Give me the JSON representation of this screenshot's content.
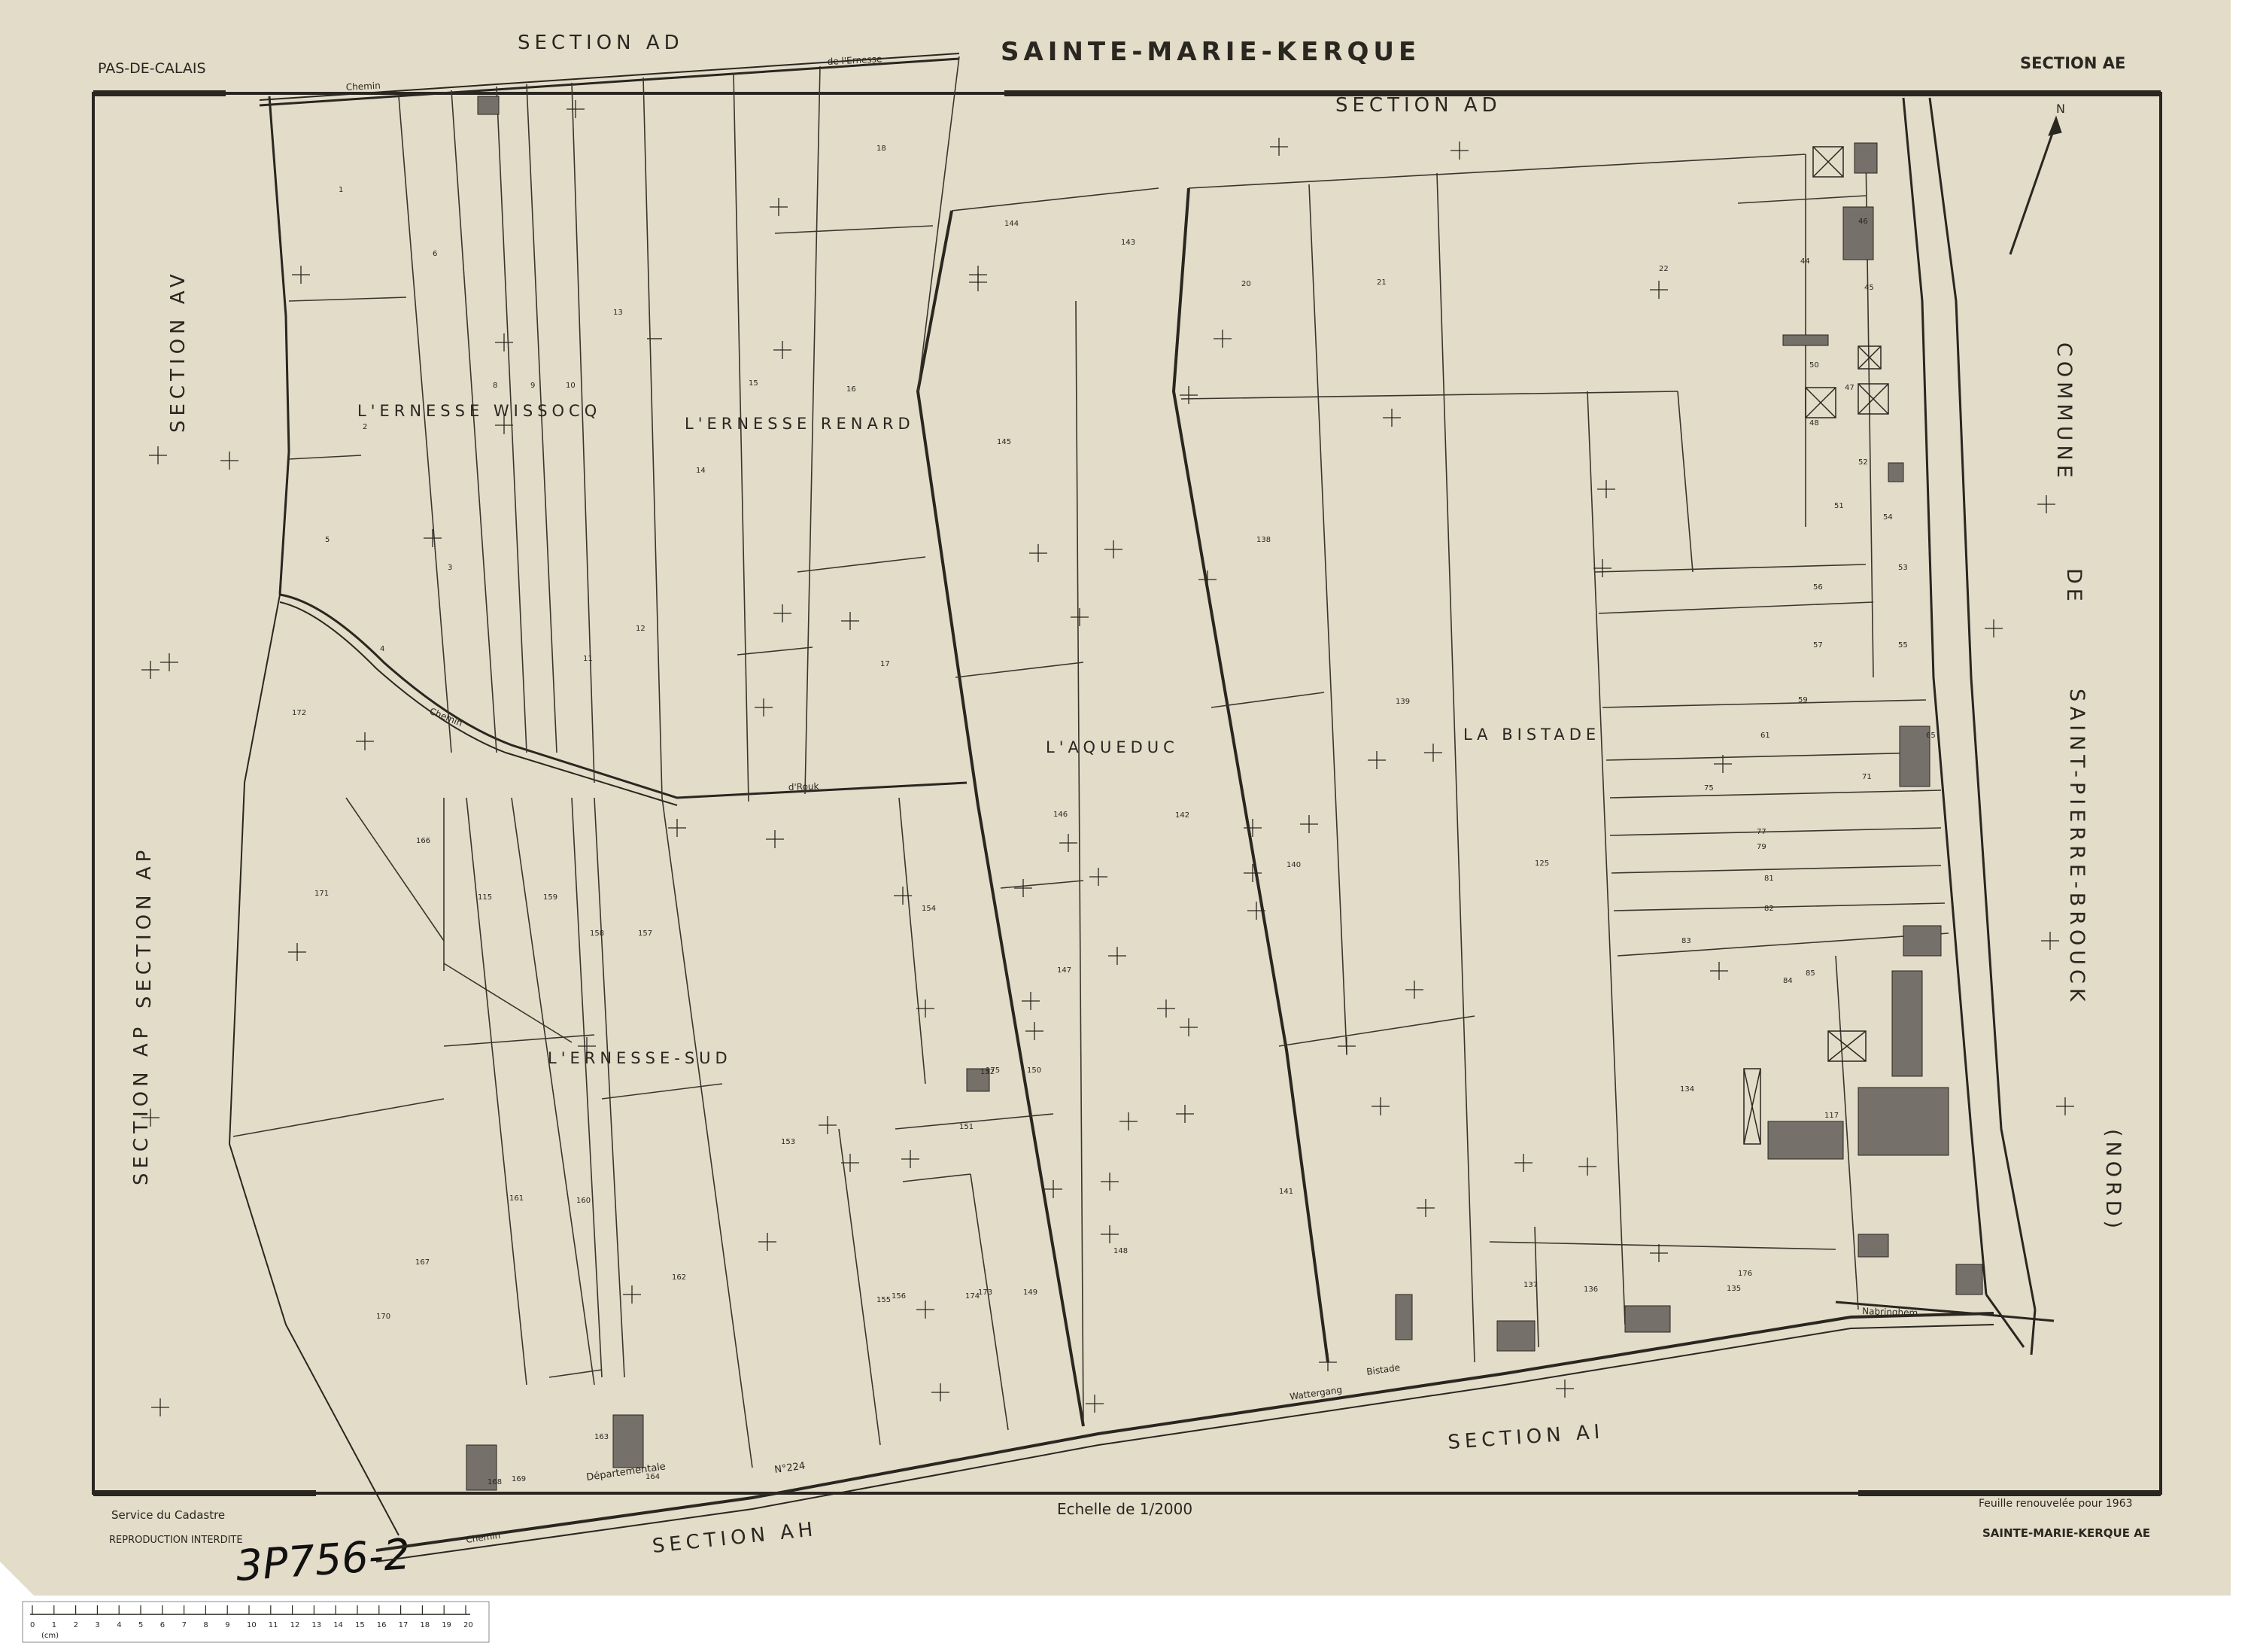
{
  "map": {
    "department": "PAS-DE-CALAIS",
    "commune": "SAINTE-MARIE-KERQUE",
    "section_label": "SECTION AE",
    "footer_left_1": "Service du Cadastre",
    "footer_left_2": "REPRODUCTION INTERDITE",
    "scale": "Echelle de 1/2000",
    "renewal": "Feuille renouvelée pour 1963",
    "footer_right": "SAINTE-MARIE-KERQUE AE",
    "archive_ref": "3P756-2",
    "north": "N",
    "adjacent_sections": {
      "top_outer": "SECTION AD",
      "top_inner": "SECTION AD",
      "left_upper": "SECTION AV",
      "left_mid": "SECTION AP",
      "left_lower": "SECTION AP",
      "bottom_right": "SECTION AI",
      "bottom_left": "SECTION AH"
    },
    "right_commune": {
      "w1": "COMMUNE",
      "w2": "DE",
      "w3": "SAINT-PIERRE-BROUCK",
      "w4": "(NORD)"
    },
    "localities": {
      "wissocq": "L'ERNESSE WISSOCQ",
      "renard": "L'ERNESSE RENARD",
      "aqueduc": "L'AQUEDUC",
      "bistade": "LA BISTADE",
      "sud": "L'ERNESSE-SUD"
    },
    "roads": {
      "chemin_top": "Chemin",
      "ernesse_top": "de l'Ernesse",
      "chemin_mid": "Chemin",
      "douck": "d'Rouk",
      "nabringhem": "Nabringhem",
      "departementale": "Départementale",
      "rd": "N°224",
      "bistade": "Bistade",
      "watergang": "Wattergang",
      "chemin_bottom": "Chemin"
    },
    "colors": {
      "paper": "#e3dcc9",
      "ink": "#2a2620",
      "building": "#76706a"
    },
    "parcels": [
      "1",
      "2",
      "3",
      "4",
      "5",
      "6",
      "8",
      "9",
      "10",
      "11",
      "12",
      "13",
      "14",
      "15",
      "16",
      "17",
      "18",
      "20",
      "21",
      "22",
      "44",
      "45",
      "46",
      "47",
      "48",
      "50",
      "51",
      "52",
      "53",
      "54",
      "55",
      "56",
      "57",
      "59",
      "61",
      "65",
      "71",
      "75",
      "77",
      "79",
      "81",
      "82",
      "83",
      "84",
      "85",
      "115",
      "117",
      "125",
      "134",
      "135",
      "136",
      "137",
      "138",
      "139",
      "140",
      "141",
      "142",
      "143",
      "144",
      "145",
      "146",
      "147",
      "148",
      "149",
      "150",
      "151",
      "152",
      "153",
      "154",
      "155",
      "156",
      "157",
      "158",
      "159",
      "160",
      "161",
      "162",
      "163",
      "164",
      "166",
      "167",
      "168",
      "169",
      "170",
      "171",
      "172",
      "173",
      "174",
      "175",
      "176"
    ],
    "ruler": {
      "unit": "(cm)",
      "ticks": [
        "0",
        "1",
        "2",
        "3",
        "4",
        "5",
        "6",
        "7",
        "8",
        "9",
        "10",
        "11",
        "12",
        "13",
        "14",
        "15",
        "16",
        "17",
        "18",
        "19",
        "20"
      ]
    }
  }
}
